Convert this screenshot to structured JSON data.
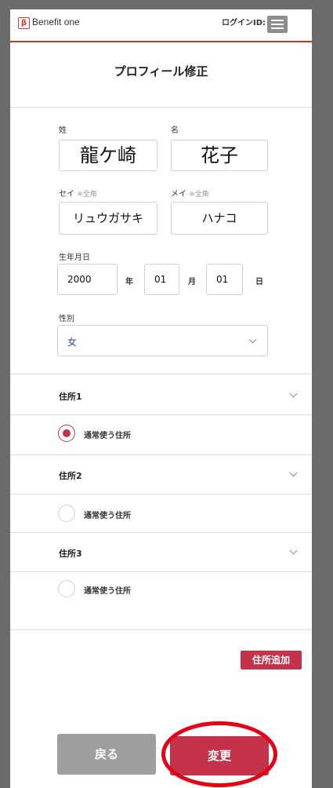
{
  "header": {
    "logo_mark": "β",
    "logo_text": "Benefit one",
    "login_id_label": "ログインID:"
  },
  "page": {
    "title": "プロフィール修正"
  },
  "form": {
    "last_name_label": "姓",
    "first_name_label": "名",
    "last_name_value": "龍ケ崎",
    "first_name_value": "花子",
    "last_kana_label": "セイ",
    "last_kana_note": "※全角",
    "first_kana_label": "メイ",
    "first_kana_note": "※全角",
    "last_kana_value": "リュウガサキ",
    "first_kana_value": "ハナコ",
    "birthdate_label": "生年月日",
    "birth_year": "2000",
    "year_unit": "年",
    "birth_month": "01",
    "month_unit": "月",
    "birth_day": "01",
    "day_unit": "日",
    "gender_label": "性別",
    "gender_value": "女"
  },
  "addresses": [
    {
      "title": "住所1",
      "default_label": "通常使う住所",
      "selected": true
    },
    {
      "title": "住所2",
      "default_label": "通常使う住所",
      "selected": false
    },
    {
      "title": "住所3",
      "default_label": "通常使う住所",
      "selected": false
    }
  ],
  "buttons": {
    "add_address": "住所追加",
    "back": "戻る",
    "change": "変更"
  },
  "colors": {
    "accent": "#c4334a",
    "header_line": "#c0392b",
    "highlight_ring": "#e60012",
    "back_button": "#9e9e9e",
    "gender_text": "#2850b4"
  }
}
